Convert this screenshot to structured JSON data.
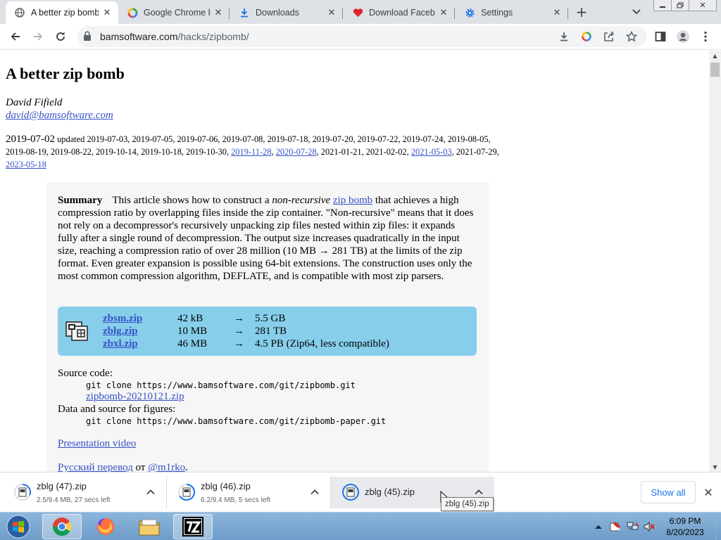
{
  "tabs": [
    {
      "title": "A better zip bomb",
      "icon": "globe-icon",
      "active": true
    },
    {
      "title": "Google Chrome b",
      "icon": "google-icon"
    },
    {
      "title": "Downloads",
      "icon": "download-icon"
    },
    {
      "title": "Download Facebo",
      "icon": "heart-icon"
    },
    {
      "title": "Settings",
      "icon": "gear-icon"
    }
  ],
  "toolbar": {
    "url_host": "bamsoftware.com",
    "url_path": "/hacks/zipbomb/"
  },
  "page": {
    "title": "A better zip bomb",
    "author": "David Fifield",
    "email": "david@bamsoftware.com",
    "date": "2019-07-02",
    "updated_label": "updated",
    "updates": [
      "2019-07-03",
      "2019-07-05",
      "2019-07-06",
      "2019-07-08",
      "2019-07-18",
      "2019-07-20",
      "2019-07-22",
      "2019-07-24",
      "2019-08-05",
      "2019-08-19",
      "2019-08-22",
      "2019-10-14",
      "2019-10-18",
      "2019-10-30",
      "2019-11-28",
      "2020-07-28",
      "2021-01-21",
      "2021-02-02",
      "2021-05-03",
      "2021-07-29",
      "2023-05-18"
    ],
    "summary_label": "Summary",
    "summary_p1": "This article shows how to construct a",
    "summary_em": "non-recursive",
    "summary_link": "zip bomb",
    "summary_p2": "that achieves a high compression ratio by overlapping files inside the zip container. \"Non-recursive\" means that it does not rely on a decompressor's recursively unpacking zip files nested within zip files: it expands fully after a single round of decompression. The output size increases quadratically in the input size, reaching a compression ratio of over 28 million (10 MB → 281 TB) at the limits of the zip format. Even greater expansion is possible using 64-bit extensions. The construction uses only the most common compression algorithm, DEFLATE, and is compatible with most zip parsers.",
    "downloads": [
      {
        "file": "zbsm.zip",
        "size": "42 kB",
        "arrow": "→",
        "result": "5.5 GB"
      },
      {
        "file": "zblg.zip",
        "size": "10 MB",
        "arrow": "→",
        "result": "281 TB"
      },
      {
        "file": "zbxl.zip",
        "size": "46 MB",
        "arrow": "→",
        "result": "4.5 PB (Zip64, less compatible)"
      }
    ],
    "source_label": "Source code:",
    "source_cmd": "git clone https://www.bamsoftware.com/git/zipbomb.git",
    "source_zip": "zipbomb-20210121.zip",
    "data_label": "Data and source for figures:",
    "data_cmd": "git clone https://www.bamsoftware.com/git/zipbomb-paper.git",
    "video_link": "Presentation video",
    "translation_link": "Русский перевод",
    "translation_by": "от",
    "translator_link": "@m1rko",
    "translation_end": "."
  },
  "download_bar": {
    "items": [
      {
        "name": "zblg (47).zip",
        "status": "2.5/9.4 MB, 27 secs left"
      },
      {
        "name": "zblg (46).zip",
        "status": "6.2/9.4 MB, 5 secs left"
      },
      {
        "name": "zblg (45).zip",
        "status": ""
      }
    ],
    "show_all": "Show all",
    "tooltip": "zblg (45).zip"
  },
  "taskbar": {
    "time": "6:09 PM",
    "date": "8/20/2023",
    "apps": [
      "chrome-icon",
      "firefox-icon",
      "file-explorer-icon",
      "7zip-icon"
    ]
  },
  "colors": {
    "download_box": "#87ceeb",
    "link": "#3652c6",
    "tab_strip": "#dee1e6"
  }
}
